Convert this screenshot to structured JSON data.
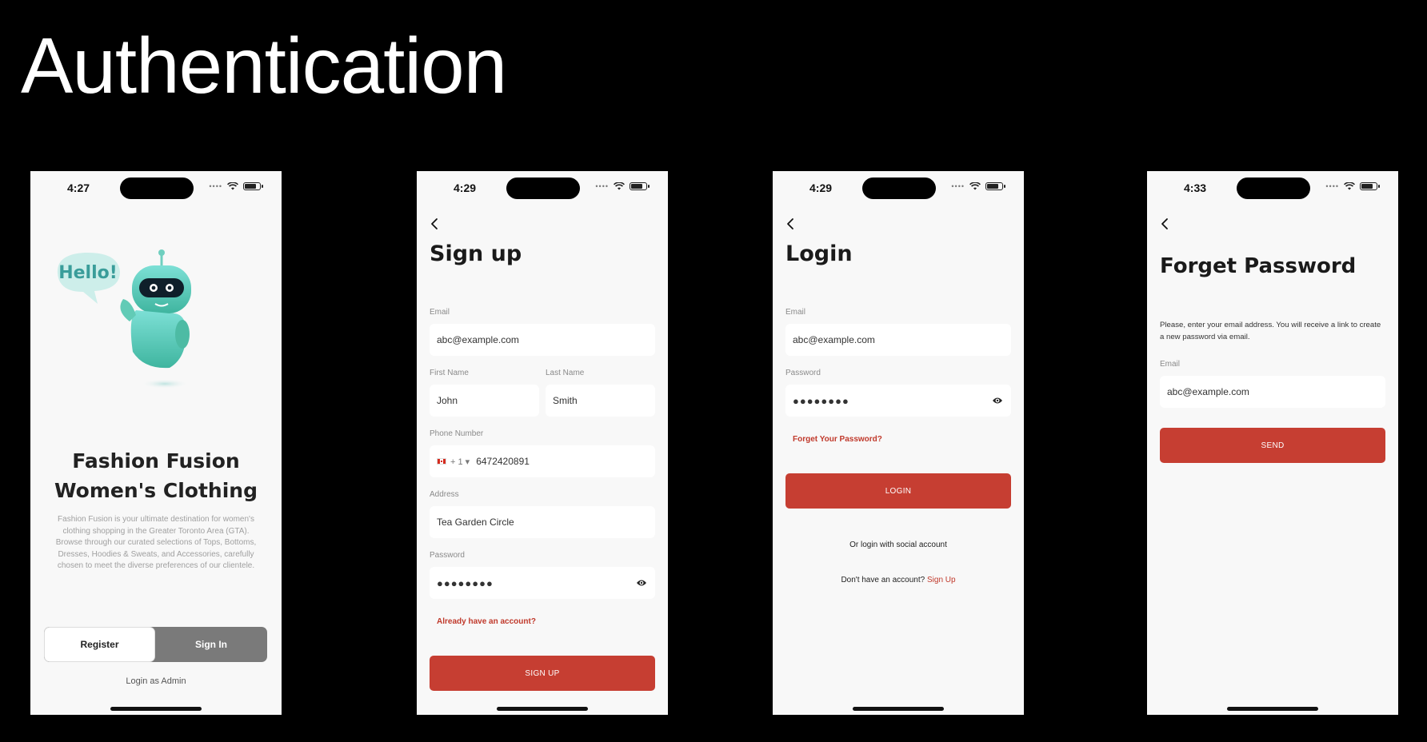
{
  "page": {
    "title": "Authentication"
  },
  "welcome": {
    "time": "4:27",
    "illustration_text": "Hello!",
    "brand_line1": "Fashion Fusion",
    "brand_line2": "Women's Clothing",
    "description": "Fashion Fusion is your ultimate destination for women's clothing shopping in the Greater Toronto Area (GTA). Browse through our curated selections of Tops, Bottoms, Dresses, Hoodies & Sweats, and Accessories, carefully chosen to meet the diverse preferences of our clientele.",
    "register_label": "Register",
    "signin_label": "Sign In",
    "admin_label": "Login as Admin"
  },
  "signup": {
    "time": "4:29",
    "title": "Sign up",
    "email_label": "Email",
    "email_value": "abc@example.com",
    "first_name_label": "First Name",
    "first_name_value": "John",
    "last_name_label": "Last Name",
    "last_name_value": "Smith",
    "phone_label": "Phone Number",
    "country_code": "+ 1 ▾",
    "phone_value": "6472420891",
    "address_label": "Address",
    "address_value": "Tea Garden Circle",
    "password_label": "Password",
    "password_value": "●●●●●●●●",
    "account_link": "Already have an account?",
    "button_label": "SIGN UP"
  },
  "login": {
    "time": "4:29",
    "title": "Login",
    "email_label": "Email",
    "email_value": "abc@example.com",
    "password_label": "Password",
    "password_value": "●●●●●●●●",
    "forgot_link": "Forget Your Password?",
    "button_label": "LOGIN",
    "social_text": "Or login with social account",
    "no_account_text": "Don't have an account?",
    "signup_link": "Sign Up"
  },
  "forgot": {
    "time": "4:33",
    "title": "Forget Password",
    "description": "Please, enter your email address. You will receive a link to create a new password via email.",
    "email_label": "Email",
    "email_value": "abc@example.com",
    "button_label": "SEND"
  },
  "colors": {
    "accent": "#c63e32",
    "background": "#000000",
    "screen": "#f8f8f8"
  },
  "icons": [
    "back-chevron-icon",
    "wifi-icon",
    "battery-icon",
    "eye-icon",
    "canada-flag-icon"
  ]
}
